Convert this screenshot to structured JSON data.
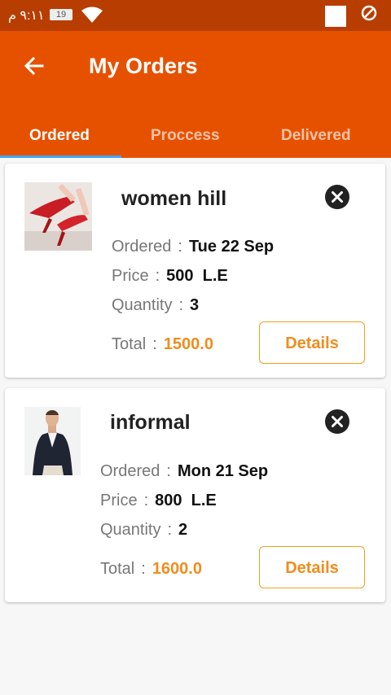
{
  "status_bar": {
    "time": "٩:١١ م",
    "battery": "19"
  },
  "app_bar": {
    "title": "My Orders"
  },
  "tabs": [
    {
      "label": "Ordered"
    },
    {
      "label": "Proccess"
    },
    {
      "label": "Delivered"
    }
  ],
  "labels": {
    "ordered": "Ordered",
    "price": "Price",
    "quantity": "Quantity",
    "total": "Total",
    "sep": ":",
    "details": "Details"
  },
  "orders": [
    {
      "name": "women hill",
      "ordered": "Tue 22 Sep",
      "price": "500  L.E",
      "quantity": "3",
      "total": "1500.0"
    },
    {
      "name": "informal",
      "ordered": "Mon 21 Sep",
      "price": "800  L.E",
      "quantity": "2",
      "total": "1600.0"
    }
  ],
  "colors": {
    "app_bar": "#e65100",
    "status_bar": "#b83d00",
    "tab_indicator": "#42a5f5",
    "accent": "#ef8d1e"
  },
  "icons": {
    "back": "arrow-left-icon",
    "cancel": "close-circle-icon",
    "wifi": "wifi-icon",
    "block": "block-icon"
  }
}
